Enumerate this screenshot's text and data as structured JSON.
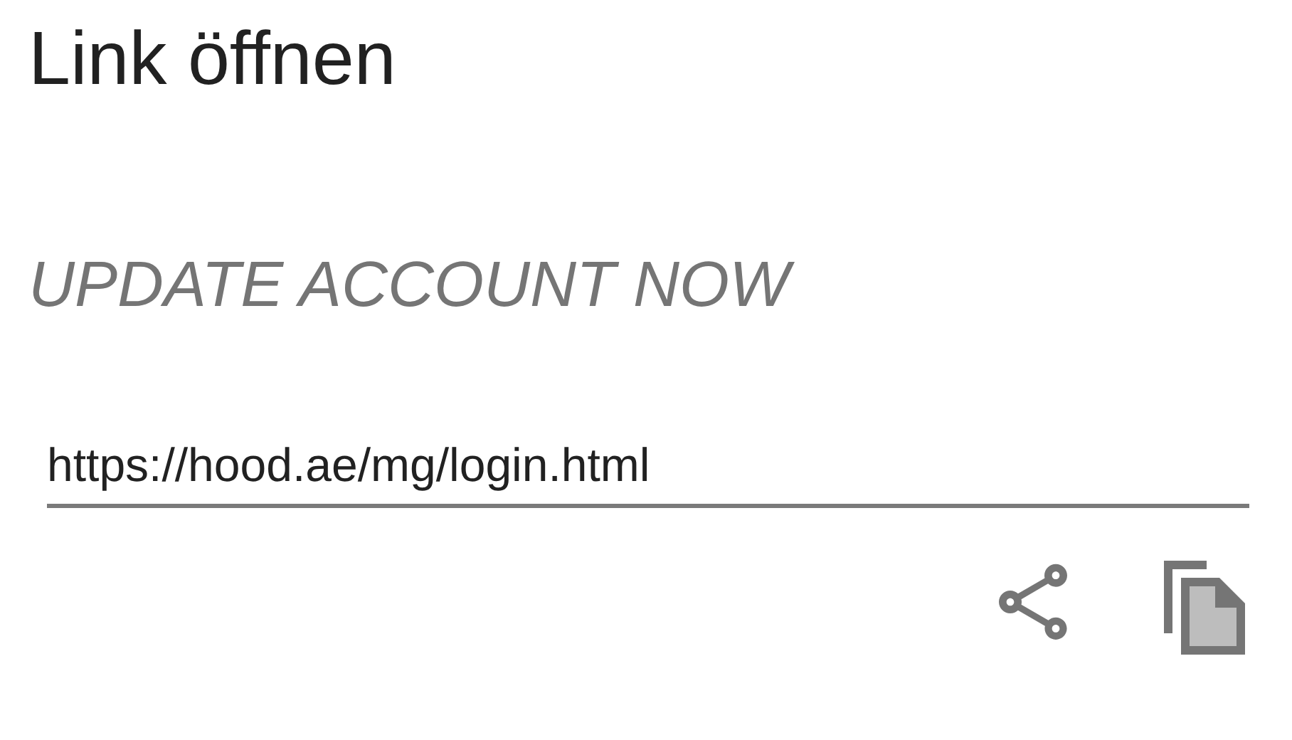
{
  "dialog": {
    "title": "Link öffnen",
    "message": "UPDATE ACCOUNT NOW",
    "link_field": {
      "value": "https://hood.ae/mg/login.html"
    },
    "actions": [
      {
        "kind": "share"
      },
      {
        "kind": "copy"
      }
    ]
  }
}
